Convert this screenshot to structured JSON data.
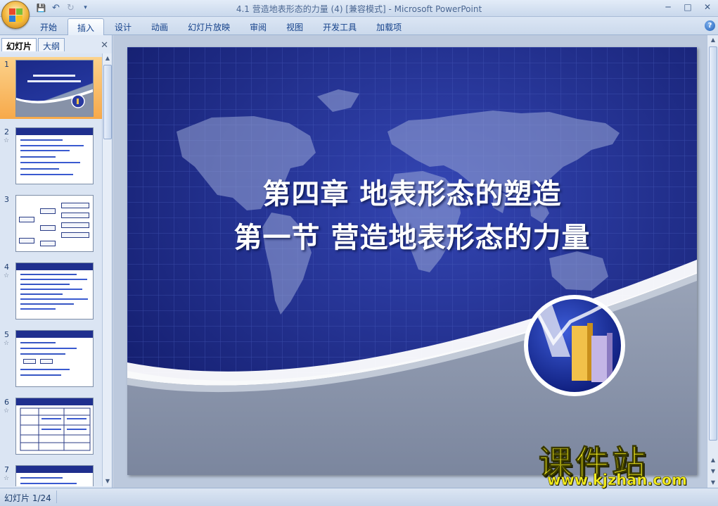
{
  "window": {
    "title": "4.1 营造地表形态的力量 (4) [兼容模式] - Microsoft PowerPoint",
    "controls": [
      "─",
      "□",
      "✕"
    ]
  },
  "quick_access": {
    "save": "💾",
    "undo": "↶",
    "redo": "↻",
    "customize": "▾"
  },
  "ribbon": {
    "tabs": [
      "开始",
      "插入",
      "设计",
      "动画",
      "幻灯片放映",
      "审阅",
      "视图",
      "开发工具",
      "加载项"
    ],
    "active_tab": "插入",
    "help": "?"
  },
  "left_pane": {
    "tabs": [
      "幻灯片",
      "大纲"
    ],
    "active_tab": "幻灯片",
    "close": "✕",
    "slides": [
      {
        "number": "1",
        "selected": true
      },
      {
        "number": "2",
        "star": "☆"
      },
      {
        "number": "3"
      },
      {
        "number": "4",
        "star": "☆"
      },
      {
        "number": "5",
        "star": "☆"
      },
      {
        "number": "6",
        "star": "☆"
      },
      {
        "number": "7",
        "star": "☆"
      }
    ]
  },
  "slide": {
    "title_line1": "第四章 地表形态的塑造",
    "title_line2": "第一节 营造地表形态的力量",
    "colors": {
      "background": "#1f2c8c",
      "grid": "#3a4fae",
      "map": "#8896c8",
      "swoosh": "#ffffff",
      "lower": "#8792a8"
    }
  },
  "status_bar": {
    "slide_indicator": "幻灯片 1/24"
  },
  "watermark": {
    "text": "课件站",
    "url": "www.kjzhan.com"
  }
}
